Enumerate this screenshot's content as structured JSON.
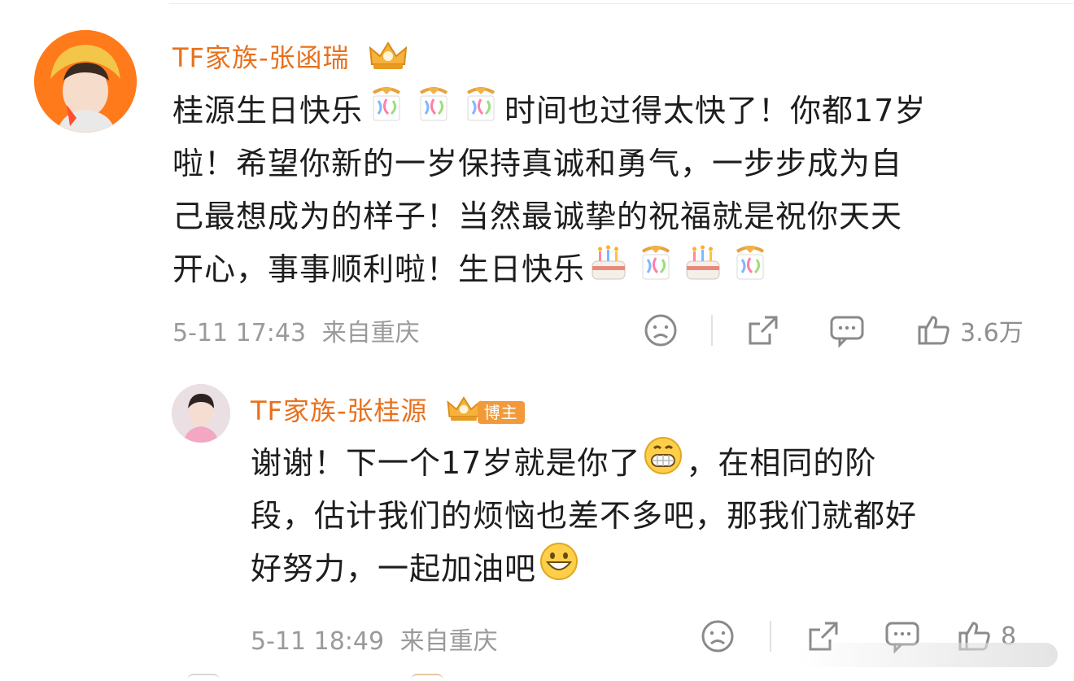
{
  "comments": [
    {
      "username": "TF家族-张函瑞",
      "text_lines": [
        [
          "桂源生日快乐",
          "时间也过得太快了！你都17岁"
        ],
        [
          "啦！希望你新的一岁保持真诚和勇气，一步步成为自"
        ],
        [
          "己最想成为的样子！当然最诚挚的祝福就是祝你天天"
        ],
        [
          "开心，事事顺利啦！生日快乐"
        ]
      ],
      "timestamp": "5-11 17:43",
      "location": "来自重庆",
      "like_count": "3.6万"
    },
    {
      "username": "TF家族-张桂源",
      "badge": "博主",
      "text_lines": [
        [
          "谢谢！下一个17岁就是你了",
          "，在相同的阶"
        ],
        [
          "段，估计我们的烦恼也差不多吧，那我们就都好"
        ],
        [
          "好努力，一起加油吧"
        ]
      ],
      "timestamp": "5-11 18:49",
      "location": "来自重庆",
      "like_count": "8"
    }
  ],
  "icons": {
    "emoji_birthday": "party-popper-emoji",
    "emoji_cake": "birthday-cake-emoji",
    "emoji_grin": "grinning-teeth-emoji",
    "emoji_smile": "big-smile-emoji",
    "action_dislike": "sad-face-icon",
    "action_share": "share-icon",
    "action_reply": "comment-icon",
    "action_like": "thumbs-up-icon",
    "user_badge": "crown-badge-icon"
  },
  "colors": {
    "username": "#e8701c",
    "badge": "#f29a3a",
    "meta": "#9a9a9a",
    "text": "#1d1d1d"
  }
}
